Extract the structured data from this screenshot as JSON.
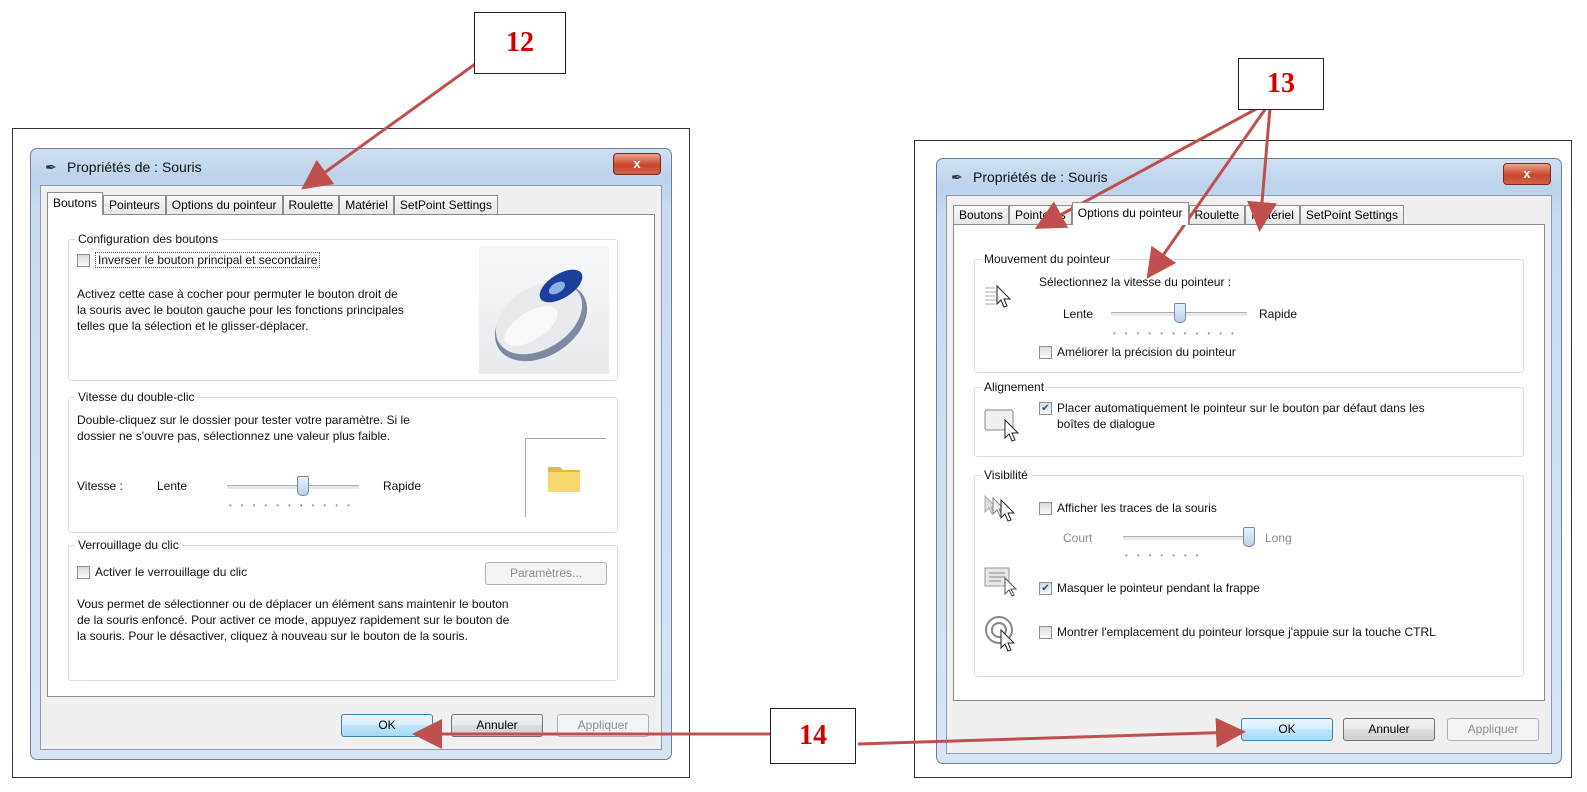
{
  "callouts": {
    "c12": "12",
    "c13": "13",
    "c14": "14"
  },
  "left": {
    "title": "Propriétés de : Souris",
    "close": "x",
    "tabs": [
      "Boutons",
      "Pointeurs",
      "Options du pointeur",
      "Roulette",
      "Matériel",
      "SetPoint Settings"
    ],
    "config": {
      "legend": "Configuration des boutons",
      "checkbox_label": "Inverser le bouton principal et secondaire",
      "desc1": "Activez cette case à cocher pour permuter le bouton droit de",
      "desc2": "la souris avec le bouton gauche pour les fonctions principales",
      "desc3": "telles que la sélection et le glisser-déplacer."
    },
    "dblclick": {
      "legend": "Vitesse du double-clic",
      "desc1": "Double-cliquez sur le dossier pour tester votre paramètre. Si le",
      "desc2": "dossier ne s'ouvre pas, sélectionnez une valeur plus faible.",
      "speed_label": "Vitesse :",
      "slow": "Lente",
      "fast": "Rapide"
    },
    "clicklock": {
      "legend": "Verrouillage du clic",
      "checkbox_label": "Activer le verrouillage du clic",
      "settings_button": "Paramètres...",
      "desc1": "Vous permet de sélectionner ou de déplacer un élément sans maintenir le bouton",
      "desc2": "de la souris enfoncé. Pour activer ce mode, appuyez rapidement sur le bouton de",
      "desc3": "la souris. Pour le désactiver, cliquez à nouveau sur le bouton de la souris."
    },
    "buttons": {
      "ok": "OK",
      "cancel": "Annuler",
      "apply": "Appliquer"
    }
  },
  "right": {
    "title": "Propriétés de : Souris",
    "close": "x",
    "tabs": [
      "Boutons",
      "Pointeurs",
      "Options du pointeur",
      "Roulette",
      "Matériel",
      "SetPoint Settings"
    ],
    "motion": {
      "legend": "Mouvement du pointeur",
      "label": "Sélectionnez la vitesse du pointeur :",
      "slow": "Lente",
      "fast": "Rapide",
      "precision_label": "Améliorer la précision du pointeur"
    },
    "snap": {
      "legend": "Alignement",
      "label1": "Placer automatiquement le pointeur sur le bouton par défaut dans les",
      "label2": "boîtes de dialogue"
    },
    "visibility": {
      "legend": "Visibilité",
      "trails_label": "Afficher les traces de la souris",
      "short": "Court",
      "long": "Long",
      "hide_label": "Masquer le pointeur pendant la frappe",
      "show_label": "Montrer l'emplacement du pointeur lorsque j'appuie sur la touche CTRL"
    },
    "buttons": {
      "ok": "OK",
      "cancel": "Annuler",
      "apply": "Appliquer"
    }
  },
  "state": {
    "left_active_tab": "Boutons",
    "right_active_tab": "Options du pointeur",
    "double_click_speed_fraction": 0.57,
    "pointer_speed_fraction": 0.5,
    "trails_length_fraction": 1.0,
    "checkboxes": {
      "swap_buttons": false,
      "click_lock": false,
      "enhance_precision": false,
      "snap_to_default": true,
      "pointer_trails": false,
      "hide_while_typing": true,
      "show_location_ctrl": false
    }
  },
  "colors": {
    "callout_text": "#d40000",
    "arrow": "#c0504d",
    "close_button": "#c8472c",
    "window_frame": "#bcd3ec"
  }
}
